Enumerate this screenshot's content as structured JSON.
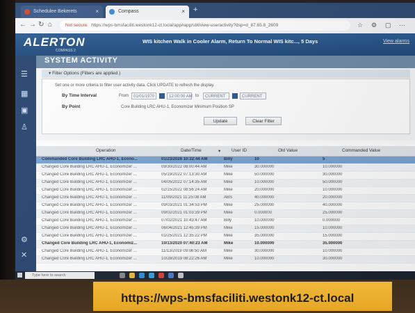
{
  "browser": {
    "tabs": [
      {
        "label": "Schedulee Bekerets"
      },
      {
        "label": "Compass"
      }
    ],
    "new_tab": "+",
    "url_security": "Not secure",
    "url": "https://wps-bmsfaciliti.westonk12-ct.local/app#app/sbt/view-useractivity?dsp=d_87.65.8_2609"
  },
  "header": {
    "logo": "ALERTON",
    "logo_sub": "COMPASS 2",
    "alarm_text": "WIS kitchen Walk in Cooler Alarm, Return To Normal WIS kitc..., 5 Days",
    "view_alarms": "View alarms"
  },
  "page": {
    "title": "SYSTEM ACTIVITY",
    "filter_header": "Filter Options (Filters are applied.)",
    "instructions": "Set one or more criteria to filter user activity data. Click UPDATE to refresh the display.",
    "by_time_label": "By Time Interval",
    "from_label": "From",
    "from_date": "01/01/1970",
    "from_time": "12:00:00 AM",
    "to_label": "to",
    "to_value": "CURRENT",
    "to_value2": "CURRENT",
    "by_point_label": "By Point",
    "point_value": "Core Building LRC AHU-1, Economizer Minimum Position SP",
    "update_label": "Update",
    "clear_label": "Clear Filter"
  },
  "table": {
    "columns": [
      "Operation",
      "Date/Time",
      "User ID",
      "Old Value",
      "Commanded Value"
    ],
    "sort_indicator": "▾",
    "rows": [
      {
        "op": "Commanded Core Building LRC AHU-1, Econo...",
        "dt": "01/23/2026 10:32:44 AM",
        "user": "Billy",
        "old": "10",
        "cmd": "5",
        "style": "sel"
      },
      {
        "op": "Changed Core Building LRC AHU-1, Economizer ...",
        "dt": "09/30/2022 08:00:44 AM",
        "user": "Mike",
        "old": "30.000000",
        "cmd": "10.000000",
        "style": ""
      },
      {
        "op": "Changed Core Building LRC AHU-1, Economizer ...",
        "dt": "05/19/2022 07:13:30 AM",
        "user": "Mike",
        "old": "50.000000",
        "cmd": "30.000000",
        "style": ""
      },
      {
        "op": "Changed Core Building LRC AHU-1, Economizer ...",
        "dt": "04/05/2022 07:14:35 AM",
        "user": "Mike",
        "old": "10.000000",
        "cmd": "50.000000",
        "style": ""
      },
      {
        "op": "Changed Core Building LRC AHU-1, Economizer ...",
        "dt": "02/15/2022 08:56:24 AM",
        "user": "Mike",
        "old": "20.000000",
        "cmd": "10.000000",
        "style": ""
      },
      {
        "op": "Changed Core Building LRC AHU-1, Economizer ...",
        "dt": "11/09/2021 11:25:08 AM",
        "user": "ABS",
        "old": "40.000000",
        "cmd": "20.000000",
        "style": ""
      },
      {
        "op": "Changed Core Building LRC AHU-1, Economizer ...",
        "dt": "09/03/2021 01:34:53 PM",
        "user": "Mike",
        "old": "25.000000",
        "cmd": "40.000000",
        "style": ""
      },
      {
        "op": "Changed Core Building LRC AHU-1, Economizer ...",
        "dt": "09/02/2021 01:03:39 PM",
        "user": "Mike",
        "old": "0.000000",
        "cmd": "25.000000",
        "style": ""
      },
      {
        "op": "Changed Core Building LRC AHU-1, Economizer ...",
        "dt": "07/02/2021 10:43:47 AM",
        "user": "Billy",
        "old": "10.000000",
        "cmd": "0.000000",
        "style": ""
      },
      {
        "op": "Changed Core Building LRC AHU-1, Economizer ...",
        "dt": "06/04/2021 12:45:39 PM",
        "user": "Mike",
        "old": "15.000000",
        "cmd": "10.000000",
        "style": ""
      },
      {
        "op": "Changed Core Building LRC AHU-1, Economizer ...",
        "dt": "01/25/2021 12:35:22 PM",
        "user": "Mike",
        "old": "35.000000",
        "cmd": "15.000000",
        "style": ""
      },
      {
        "op": "Changed Core Building LRC AHU-1, Economiz...",
        "dt": "10/13/2020 07:40:23 AM",
        "user": "Mike",
        "old": "10.000000",
        "cmd": "35.000000",
        "style": "bold"
      },
      {
        "op": "Changed Core Building LRC AHU-1, Economizer ...",
        "dt": "11/13/2019 09:06:50 AM",
        "user": "Mike",
        "old": "30.000000",
        "cmd": "10.000000",
        "style": ""
      },
      {
        "op": "Changed Core Building LRC AHU-1, Economizer ...",
        "dt": "10/28/2019 08:22:26 AM",
        "user": "Mike",
        "old": "10.000000",
        "cmd": "30.000000",
        "style": ""
      }
    ]
  },
  "taskbar": {
    "search_placeholder": "Type here to search"
  },
  "caption": "https://wps-bmsfaciliti.westonk12-ct.local",
  "colors": {
    "header_blue": "#1f4a7c",
    "selected_row": "#7ba3cf",
    "caption_bg": "#e6a625"
  }
}
